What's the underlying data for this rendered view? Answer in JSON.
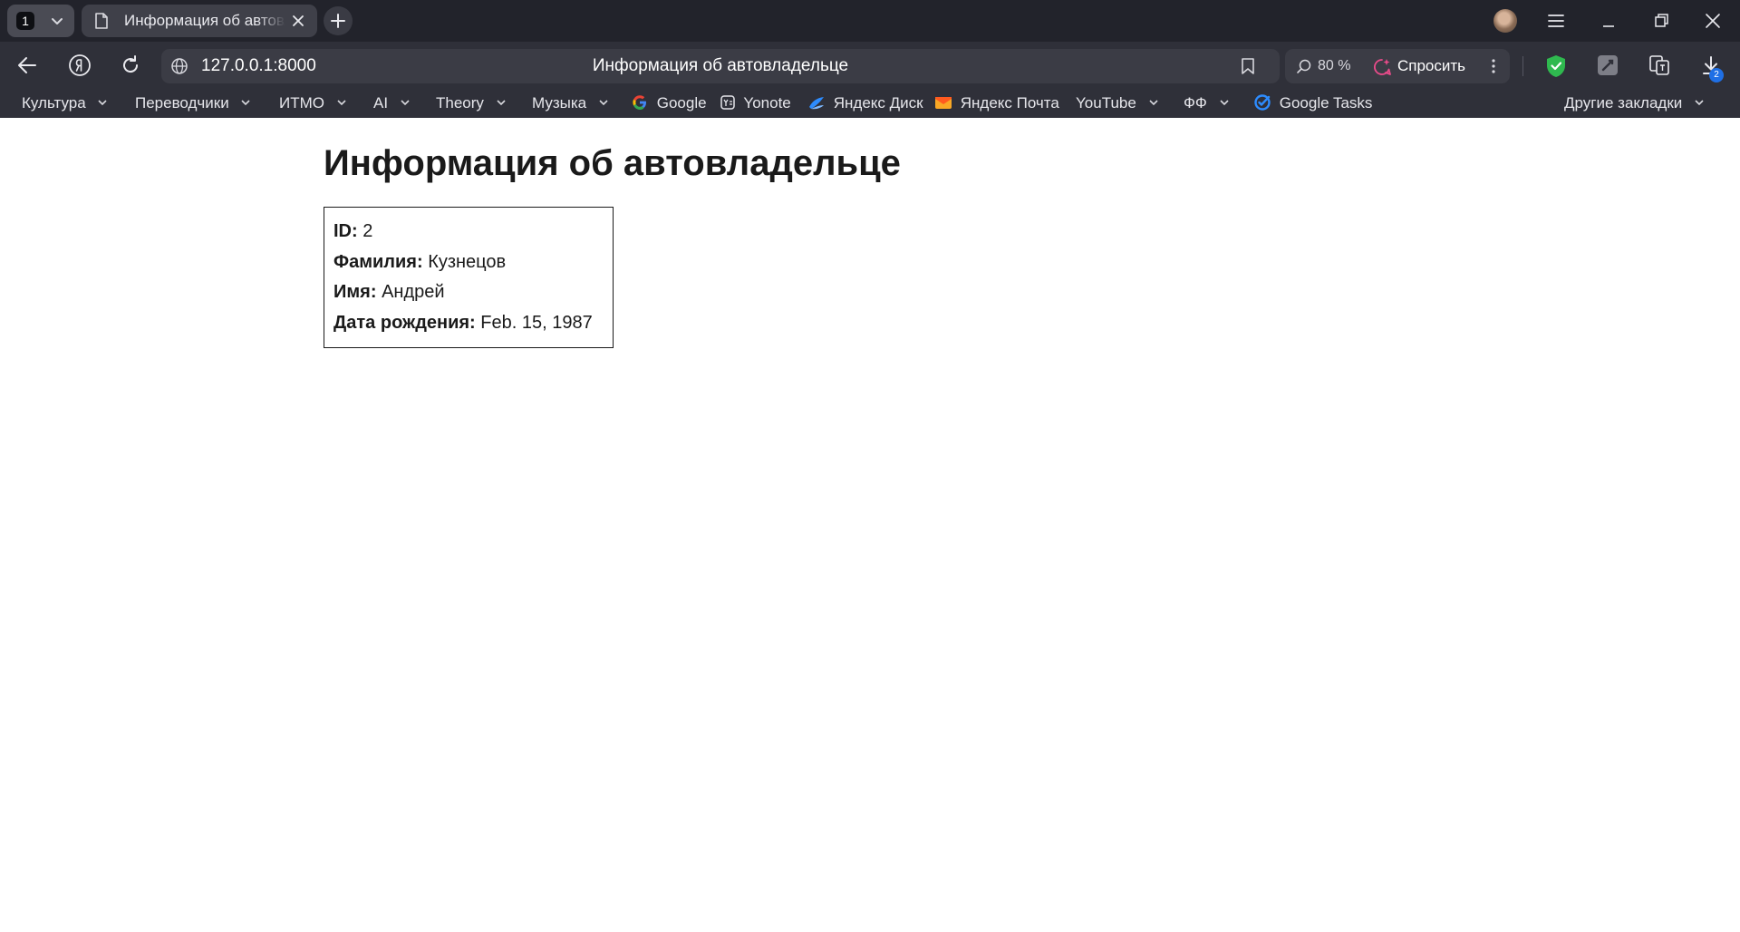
{
  "browser": {
    "tab_counter": "1",
    "tab_title": "Информация об автовладельце",
    "zoom": "80 %",
    "ask_label": "Спросить",
    "download_badge": "2"
  },
  "address_bar": {
    "url": "127.0.0.1:8000",
    "page_title": "Информация об автовладельце"
  },
  "bookmarks": {
    "culture": "Культура",
    "translators": "Переводчики",
    "itmo": "ИТМО",
    "ai": "AI",
    "theory": "Theory",
    "music": "Музыка",
    "google": "Google",
    "yonote": "Yonote",
    "yadisk": "Яндекс Диск",
    "yamail": "Яндекс Почта",
    "youtube": "YouTube",
    "ff": "ФФ",
    "google_tasks": "Google Tasks",
    "other": "Другие закладки"
  },
  "page": {
    "heading": "Информация об автовладельце",
    "fields": [
      {
        "label": "ID:",
        "value": "2"
      },
      {
        "label": "Фамилия:",
        "value": "Кузнецов"
      },
      {
        "label": "Имя:",
        "value": "Андрей"
      },
      {
        "label": "Дата рождения:",
        "value": "Feb. 15, 1987"
      }
    ]
  },
  "colors": {
    "chrome_dark": "#22232b",
    "toolbar": "#2f3039",
    "protect_green": "#2fb94f",
    "ask_pink": "#e94b8a",
    "badge_blue": "#1f6fe5"
  }
}
